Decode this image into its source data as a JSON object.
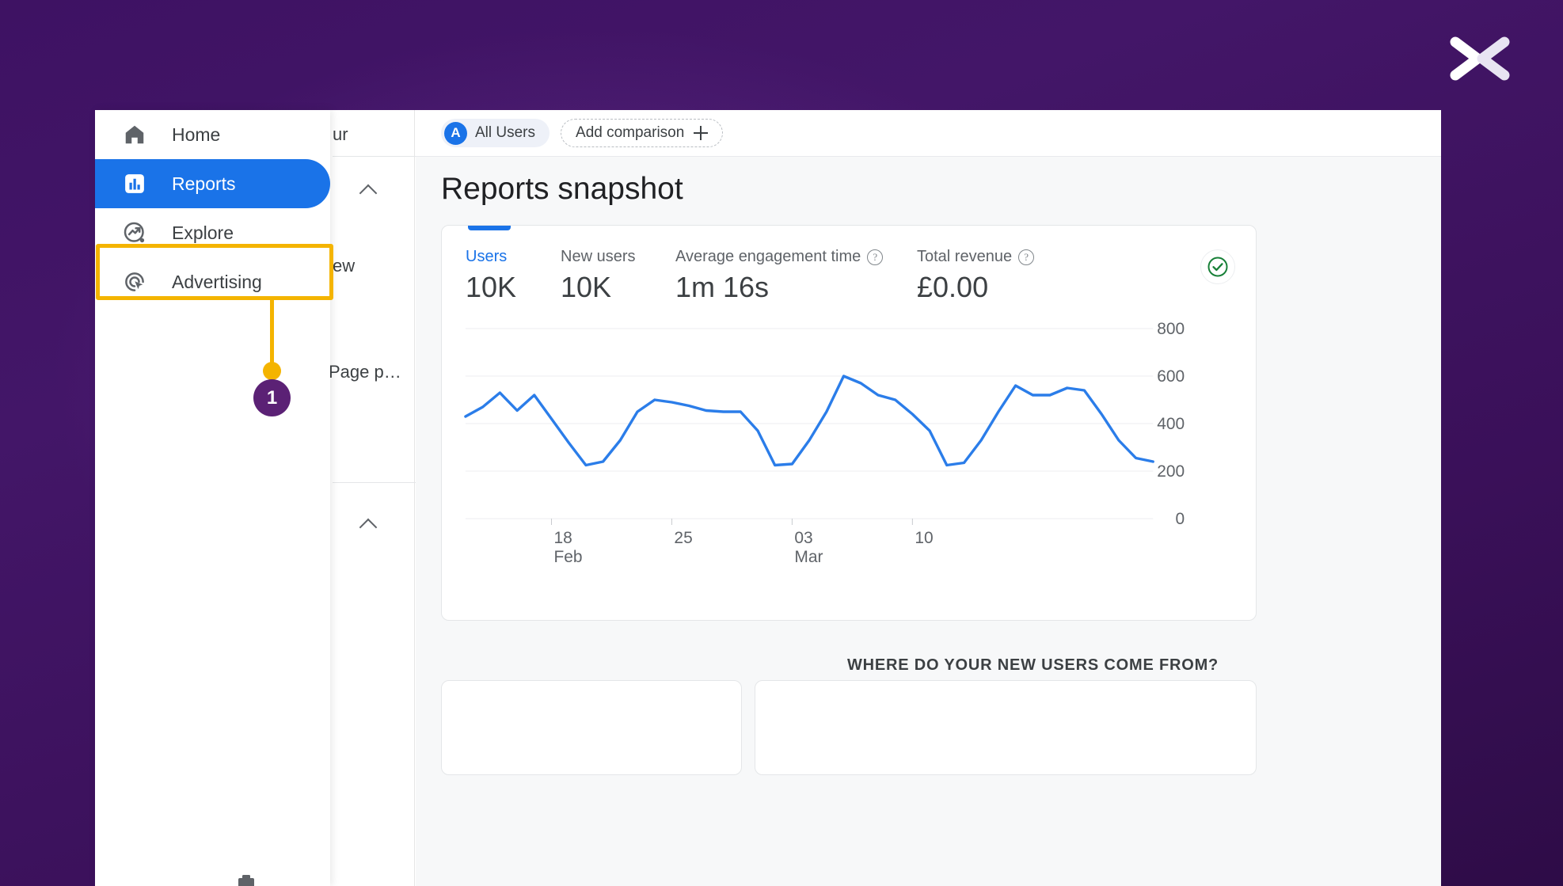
{
  "theme": {
    "bg_purple": "#3e1263",
    "accent_blue": "#1a73e8",
    "highlight_yellow": "#f4b400",
    "badge_purple": "#5b2175",
    "green": "#188038"
  },
  "branding": {
    "logo": "x-logo"
  },
  "callout": {
    "step_number": "1"
  },
  "sidebar": {
    "items": [
      {
        "label": "Home",
        "icon": "home-icon",
        "active": false
      },
      {
        "label": "Reports",
        "icon": "bar-chart-icon",
        "active": true
      },
      {
        "label": "Explore",
        "icon": "explore-trend-icon",
        "active": false
      },
      {
        "label": "Advertising",
        "icon": "advertising-target-icon",
        "active": false
      }
    ]
  },
  "app_nav_partial": {
    "rows": [
      {
        "text": "ur",
        "kind": "text"
      },
      {
        "text": "",
        "kind": "chevron-up"
      },
      {
        "text": "ew",
        "kind": "text"
      },
      {
        "text": "Page p…",
        "kind": "text"
      },
      {
        "text": "",
        "kind": "chevron-up"
      }
    ]
  },
  "topbar": {
    "all_users_chip": {
      "avatar_letter": "A",
      "label": "All Users"
    },
    "add_comparison": {
      "label": "Add comparison",
      "icon": "plus-icon"
    }
  },
  "main": {
    "page_title": "Reports snapshot",
    "bottom_heading": "WHERE DO YOUR NEW USERS COME FROM?",
    "status_icon": "check-circle-icon"
  },
  "metrics": [
    {
      "label": "Users",
      "value": "10K",
      "active": true,
      "help": false
    },
    {
      "label": "New users",
      "value": "10K",
      "active": false,
      "help": false
    },
    {
      "label": "Average engagement time",
      "value": "1m 16s",
      "active": false,
      "help": true
    },
    {
      "label": "Total revenue",
      "value": "£0.00",
      "active": false,
      "help": true
    }
  ],
  "chart_data": {
    "type": "line",
    "title": "",
    "xlabel": "",
    "ylabel": "",
    "ylim": [
      0,
      800
    ],
    "yticks": [
      800,
      600,
      400,
      200,
      0
    ],
    "grid": true,
    "legend": "none",
    "line_color": "#2b7de9",
    "xticks": [
      {
        "pos": 5,
        "label": "18",
        "sublabel": "Feb"
      },
      {
        "pos": 12,
        "label": "25",
        "sublabel": ""
      },
      {
        "pos": 19,
        "label": "03",
        "sublabel": "Mar"
      },
      {
        "pos": 26,
        "label": "10",
        "sublabel": ""
      }
    ],
    "series": [
      {
        "name": "Users",
        "values": [
          430,
          470,
          530,
          455,
          520,
          420,
          320,
          225,
          240,
          330,
          450,
          500,
          490,
          475,
          455,
          450,
          450,
          370,
          225,
          230,
          330,
          450,
          600,
          570,
          520,
          500,
          440,
          370,
          225,
          235,
          330,
          450,
          560,
          520,
          520,
          550,
          540,
          440,
          330,
          255,
          240
        ]
      }
    ]
  }
}
